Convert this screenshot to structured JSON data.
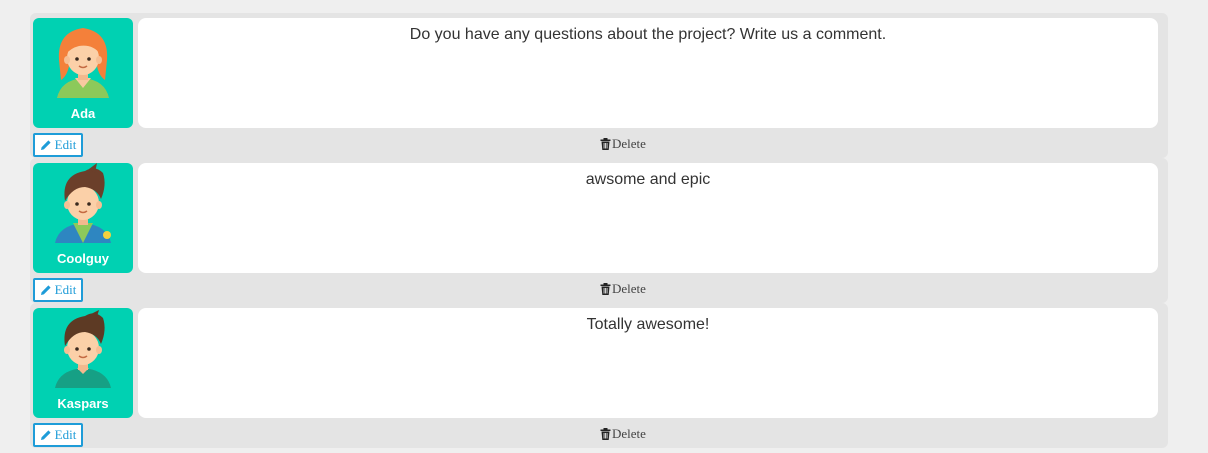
{
  "comments": [
    {
      "username": "Ada",
      "avatar_icon": "girl-avatar-icon",
      "text": "Do you have any questions about the project? Write us a comment.",
      "edit_label": "Edit",
      "delete_label": "Delete"
    },
    {
      "username": "Coolguy",
      "avatar_icon": "boy-jacket-avatar-icon",
      "text": "awsome and epic",
      "edit_label": "Edit",
      "delete_label": "Delete"
    },
    {
      "username": "Kaspars",
      "avatar_icon": "boy-avatar-icon",
      "text": "Totally awesome!",
      "edit_label": "Edit",
      "delete_label": "Delete"
    }
  ],
  "colors": {
    "avatar_bg": "#00d1b2",
    "edit_accent": "#1e9cd8",
    "card_bg": "#e4e4e4"
  }
}
